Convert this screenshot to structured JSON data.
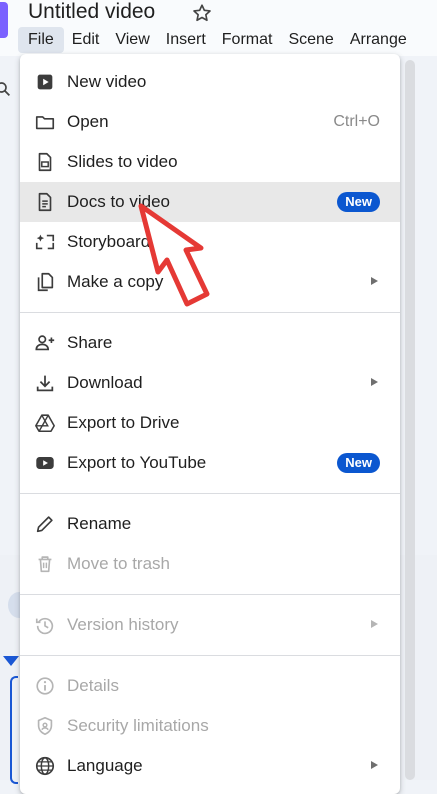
{
  "document": {
    "title": "Untitled video"
  },
  "menubar": {
    "items": [
      "File",
      "Edit",
      "View",
      "Insert",
      "Format",
      "Scene",
      "Arrange"
    ]
  },
  "file_menu": {
    "new_video": "New video",
    "open": "Open",
    "open_shortcut": "Ctrl+O",
    "slides_to_video": "Slides to video",
    "docs_to_video": "Docs to video",
    "docs_badge": "New",
    "storyboard": "Storyboard",
    "make_a_copy": "Make a copy",
    "share": "Share",
    "download": "Download",
    "export_to_drive": "Export to Drive",
    "export_to_youtube": "Export to YouTube",
    "youtube_badge": "New",
    "rename": "Rename",
    "move_to_trash": "Move to trash",
    "version_history": "Version history",
    "details": "Details",
    "security_limitations": "Security limitations",
    "language": "Language"
  },
  "colors": {
    "accent_badge": "#0b57d0",
    "highlight_row": "#e8e8e8",
    "annotation_arrow": "#e53935",
    "app_logo": "#7b61ff"
  },
  "icons": {
    "new_video": "play-box-icon",
    "open": "folder-icon",
    "slides_to_video": "slides-doc-icon",
    "docs_to_video": "doc-lines-icon",
    "storyboard": "sparkle-frame-icon",
    "make_a_copy": "copy-icon",
    "share": "person-add-icon",
    "download": "download-icon",
    "export_to_drive": "drive-icon",
    "export_to_youtube": "youtube-icon",
    "rename": "pencil-icon",
    "move_to_trash": "trash-icon",
    "version_history": "history-icon",
    "details": "info-icon",
    "security_limitations": "shield-icon",
    "language": "globe-icon"
  }
}
